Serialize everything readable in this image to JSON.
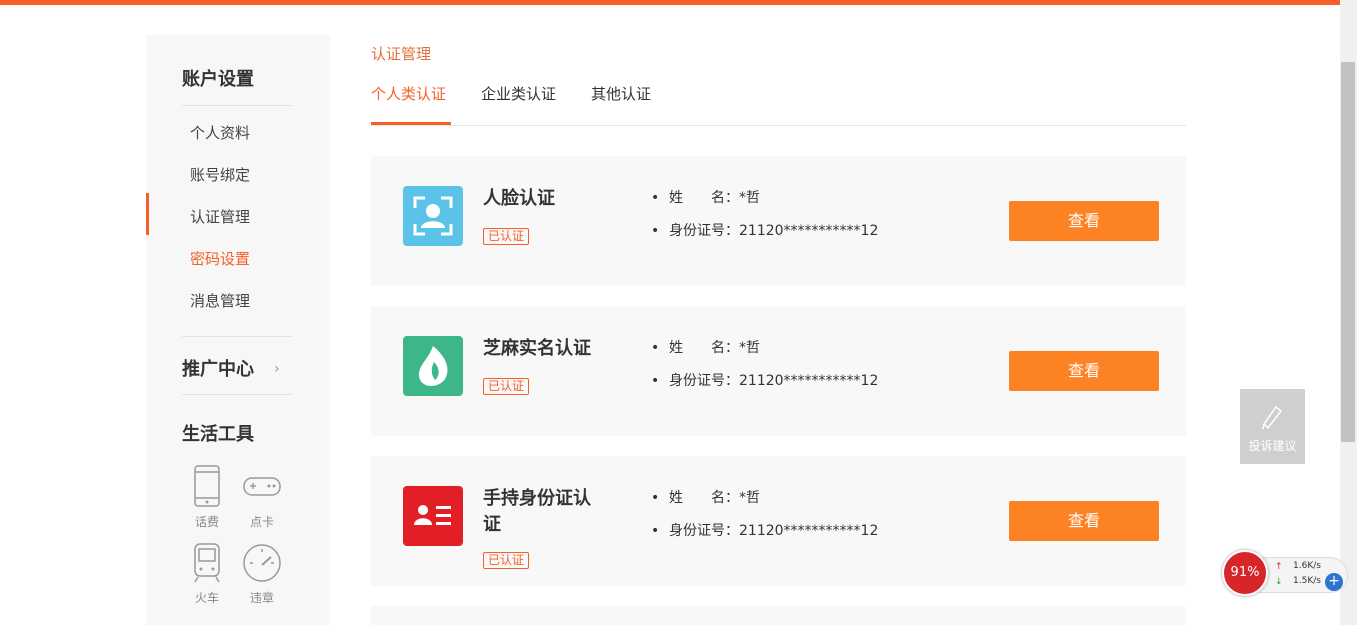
{
  "sidebar": {
    "account_title": "账户设置",
    "items": [
      {
        "label": "个人资料"
      },
      {
        "label": "账号绑定"
      },
      {
        "label": "认证管理"
      },
      {
        "label": "密码设置"
      },
      {
        "label": "消息管理"
      }
    ],
    "promo_title": "推广中心",
    "promo_chevron": "›",
    "tools_title": "生活工具",
    "tools": [
      {
        "label": "话费",
        "icon": "phone-icon"
      },
      {
        "label": "点卡",
        "icon": "gamepad-icon"
      },
      {
        "label": "火车",
        "icon": "train-icon"
      },
      {
        "label": "违章",
        "icon": "speedometer-icon"
      }
    ]
  },
  "main": {
    "breadcrumb": "认证管理",
    "tabs": [
      {
        "label": "个人类认证"
      },
      {
        "label": "企业类认证"
      },
      {
        "label": "其他认证"
      }
    ],
    "cards": [
      {
        "title": "人脸认证",
        "badge": "已认证",
        "name_label": "姓　　名：",
        "name_value": "*哲",
        "id_label": "身份证号：",
        "id_value": "21120***********12",
        "button": "查看",
        "icon": "face-scan-icon",
        "icon_color": "#5bc3e8"
      },
      {
        "title": "芝麻实名认证",
        "badge": "已认证",
        "name_label": "姓　　名：",
        "name_value": "*哲",
        "id_label": "身份证号：",
        "id_value": "21120***********12",
        "button": "查看",
        "icon": "sesame-icon",
        "icon_color": "#3db689"
      },
      {
        "title": "手持身份证认证",
        "badge": "已认证",
        "name_label": "姓　　名：",
        "name_value": "*哲",
        "id_label": "身份证号：",
        "id_value": "21120***********12",
        "button": "查看",
        "icon": "id-card-icon",
        "icon_color": "#e21f26"
      }
    ]
  },
  "widgets": {
    "feedback_label": "投诉建议",
    "net_percent": "91%",
    "net_up": "1.6K/s",
    "net_down": "1.5K/s"
  },
  "colors": {
    "accent": "#f5602a",
    "button": "#fc8223"
  }
}
